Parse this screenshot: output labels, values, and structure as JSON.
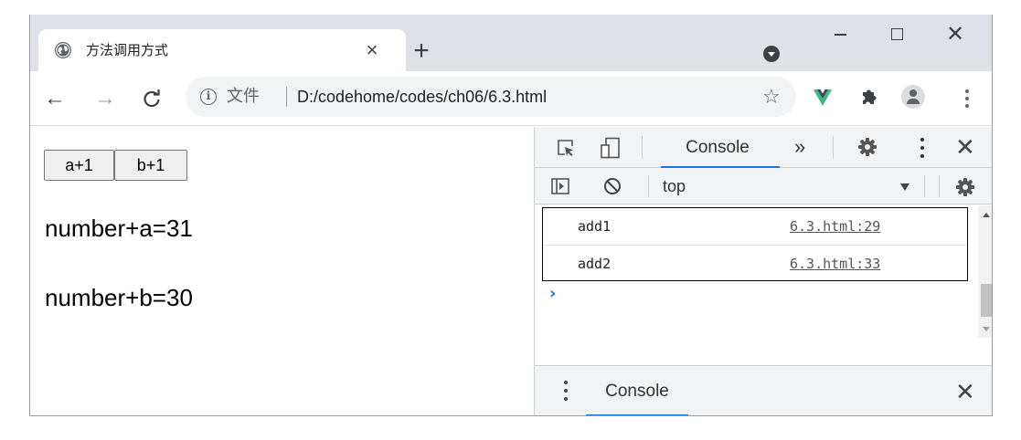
{
  "tab": {
    "title": "方法调用方式",
    "close": "×"
  },
  "new_tab": "+",
  "window_controls": {
    "close": "✕"
  },
  "nav": {
    "back": "←",
    "forward": "→",
    "reload": "C"
  },
  "omnibox": {
    "info": "i",
    "origin": "文件",
    "url": "D:/codehome/codes/ch06/6.3.html",
    "star": "☆"
  },
  "page": {
    "buttons": [
      "a+1",
      "b+1"
    ],
    "results": [
      "number+a=31",
      "number+b=30"
    ]
  },
  "devtools": {
    "active_tab": "Console",
    "more_tabs": "»",
    "close": "✕",
    "context": "top",
    "logs": [
      {
        "message": "add1",
        "source": "6.3.html:29"
      },
      {
        "message": "add2",
        "source": "6.3.html:33"
      }
    ],
    "prompt": "›",
    "drawer_tab": "Console",
    "drawer_close": "✕"
  },
  "colors": {
    "accent": "#1a73e8",
    "vue": "#41b883",
    "tabstrip": "#dee1e6",
    "toolbar_gray": "#f1f3f4"
  },
  "icons": [
    "globe-icon",
    "info-icon",
    "star-icon",
    "vue-devtools-icon",
    "extensions-icon",
    "profile-icon",
    "inspect-icon",
    "device-toggle-icon",
    "settings-icon",
    "sidebar-toggle-icon",
    "clear-console-icon"
  ]
}
